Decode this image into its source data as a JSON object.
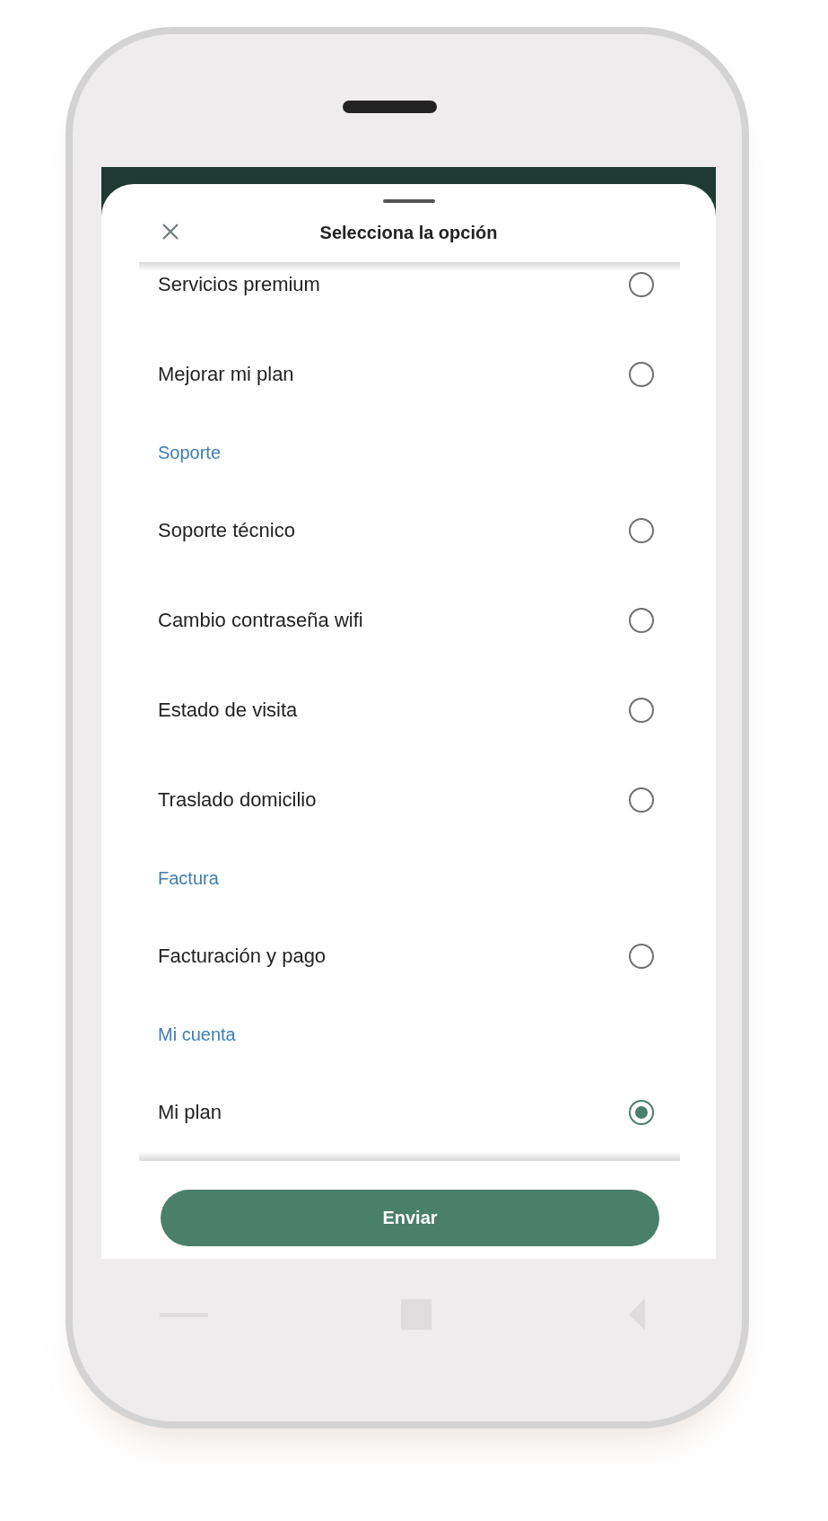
{
  "sheet": {
    "title": "Selecciona la opción"
  },
  "items": [
    {
      "kind": "option",
      "label": "Servicios premium",
      "selected": false
    },
    {
      "kind": "option",
      "label": "Mejorar mi plan",
      "selected": false
    },
    {
      "kind": "heading",
      "label": "Soporte"
    },
    {
      "kind": "option",
      "label": "Soporte técnico",
      "selected": false
    },
    {
      "kind": "option",
      "label": "Cambio contraseña wifi",
      "selected": false
    },
    {
      "kind": "option",
      "label": "Estado de visita",
      "selected": false
    },
    {
      "kind": "option",
      "label": "Traslado domicilio",
      "selected": false
    },
    {
      "kind": "heading",
      "label": "Factura"
    },
    {
      "kind": "option",
      "label": "Facturación y pago",
      "selected": false
    },
    {
      "kind": "heading",
      "label": "Mi cuenta"
    },
    {
      "kind": "option",
      "label": "Mi plan",
      "selected": true
    }
  ],
  "submit_button": "Enviar"
}
